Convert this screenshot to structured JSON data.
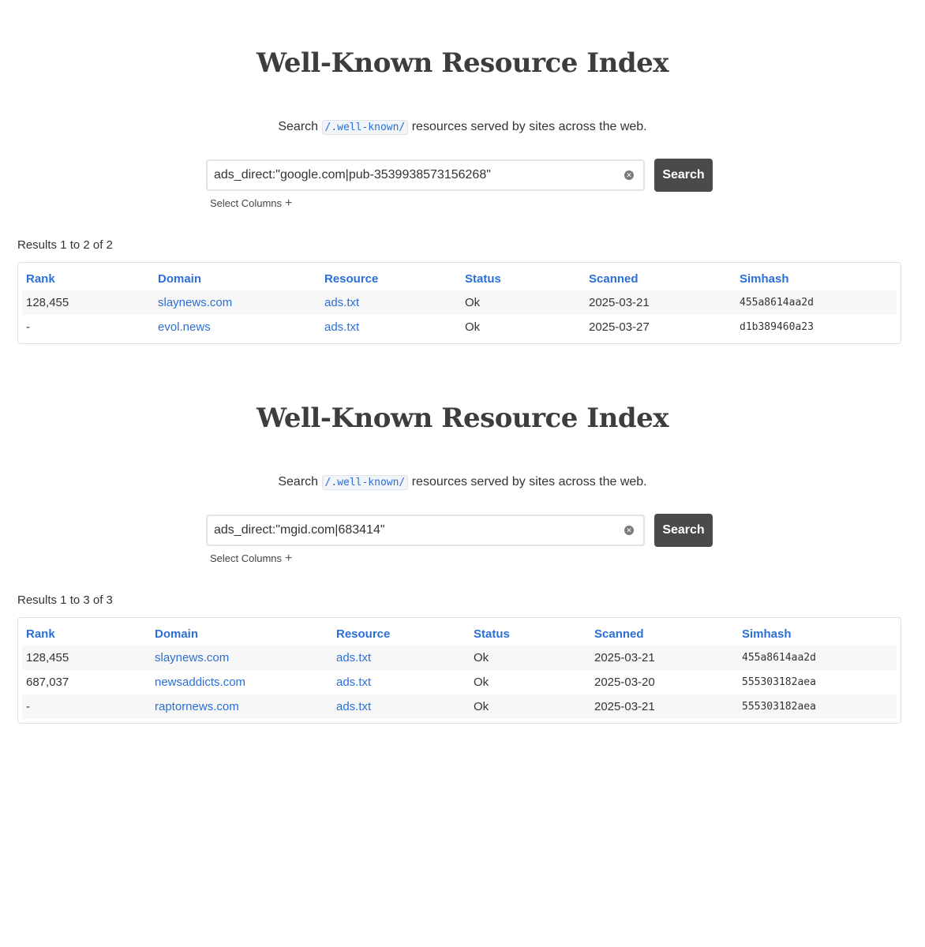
{
  "sections": [
    {
      "title": "Well-Known Resource Index",
      "subtitle": {
        "before": "Search",
        "code": "/.well-known/",
        "after": "resources served by sites across the web."
      },
      "search": {
        "value": "ads_direct:\"google.com|pub-3539938573156268\"",
        "button": "Search"
      },
      "select_columns": "Select Columns",
      "results_count": "Results 1 to 2 of 2",
      "columns": [
        "Rank",
        "Domain",
        "Resource",
        "Status",
        "Scanned",
        "Simhash"
      ],
      "rows": [
        {
          "rank": "128,455",
          "domain": "slaynews.com",
          "resource": "ads.txt",
          "status": "Ok",
          "scanned": "2025-03-21",
          "simhash": "455a8614aa2d"
        },
        {
          "rank": "-",
          "domain": "evol.news",
          "resource": "ads.txt",
          "status": "Ok",
          "scanned": "2025-03-27",
          "simhash": "d1b389460a23"
        }
      ]
    },
    {
      "title": "Well-Known Resource Index",
      "subtitle": {
        "before": "Search",
        "code": "/.well-known/",
        "after": "resources served by sites across the web."
      },
      "search": {
        "value": "ads_direct:\"mgid.com|683414\"",
        "button": "Search"
      },
      "select_columns": "Select Columns",
      "results_count": "Results 1 to 3 of 3",
      "columns": [
        "Rank",
        "Domain",
        "Resource",
        "Status",
        "Scanned",
        "Simhash"
      ],
      "rows": [
        {
          "rank": "128,455",
          "domain": "slaynews.com",
          "resource": "ads.txt",
          "status": "Ok",
          "scanned": "2025-03-21",
          "simhash": "455a8614aa2d"
        },
        {
          "rank": "687,037",
          "domain": "newsaddicts.com",
          "resource": "ads.txt",
          "status": "Ok",
          "scanned": "2025-03-20",
          "simhash": "555303182aea"
        },
        {
          "rank": "-",
          "domain": "raptornews.com",
          "resource": "ads.txt",
          "status": "Ok",
          "scanned": "2025-03-21",
          "simhash": "555303182aea"
        }
      ]
    }
  ]
}
